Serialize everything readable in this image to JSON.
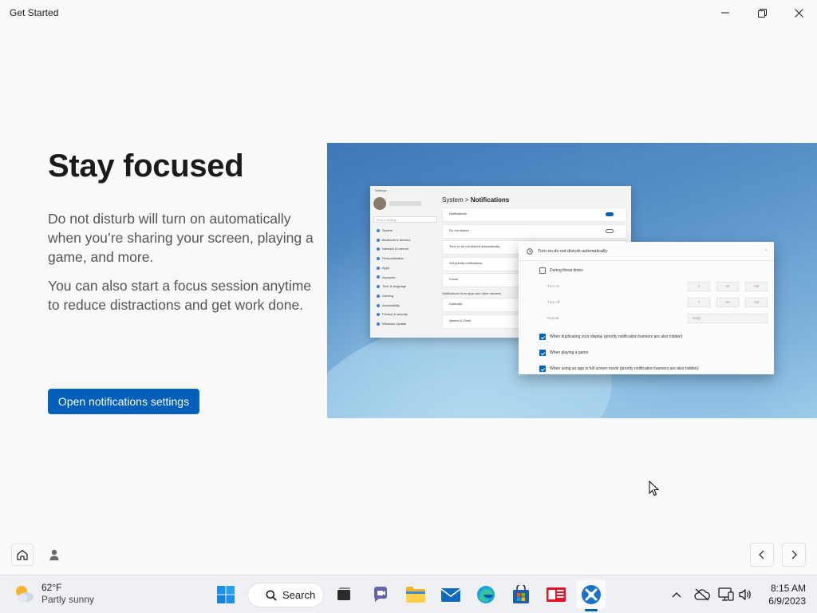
{
  "window": {
    "title": "Get Started"
  },
  "content": {
    "heading": "Stay focused",
    "paragraph1": "Do not disturb will turn on automatically when you’re sharing your screen, playing a game, and more.",
    "paragraph2": "You can also start a focus session anytime to reduce distractions and get work done.",
    "primary_button": "Open notifications settings"
  },
  "illustration": {
    "settings_title": "Settings",
    "breadcrumb_parent": "System",
    "breadcrumb_sep": ">",
    "breadcrumb_current": "Notifications",
    "search_placeholder": "Find a setting",
    "nav_items": [
      "System",
      "Bluetooth & devices",
      "Network & internet",
      "Personalization",
      "Apps",
      "Accounts",
      "Time & language",
      "Gaming",
      "Accessibility",
      "Privacy & security",
      "Windows Update"
    ],
    "rows": [
      "Notifications",
      "Do not disturb",
      "Turn on do not disturb automatically",
      "Set priority notifications",
      "Focus"
    ],
    "section_label": "Notifications from apps and other senders",
    "app_rows": [
      "Calendar",
      "Alarms & Clock"
    ],
    "popup": {
      "title": "Turn on do not disturb automatically",
      "during_times": "During these times",
      "turn_on": "Turn on",
      "turn_off": "Turn off",
      "repeat": "Repeat",
      "on_hour": "1",
      "on_minute": "00",
      "on_ampm": "AM",
      "off_hour": "7",
      "off_minute": "00",
      "off_ampm": "AM",
      "repeat_value": "Daily",
      "check_display": "When duplicating your display (priority notification banners are also hidden)",
      "check_game": "When playing a game",
      "check_fullscreen": "When using an app in full screen mode (priority notification banners are also hidden)"
    }
  },
  "taskbar": {
    "weather_temp": "62°F",
    "weather_desc": "Partly sunny",
    "search_label": "Search",
    "time": "8:15 AM",
    "date": "6/9/2023"
  },
  "colors": {
    "accent": "#005fb8",
    "background": "#f9f9f9",
    "taskbar": "#eef0f3"
  }
}
